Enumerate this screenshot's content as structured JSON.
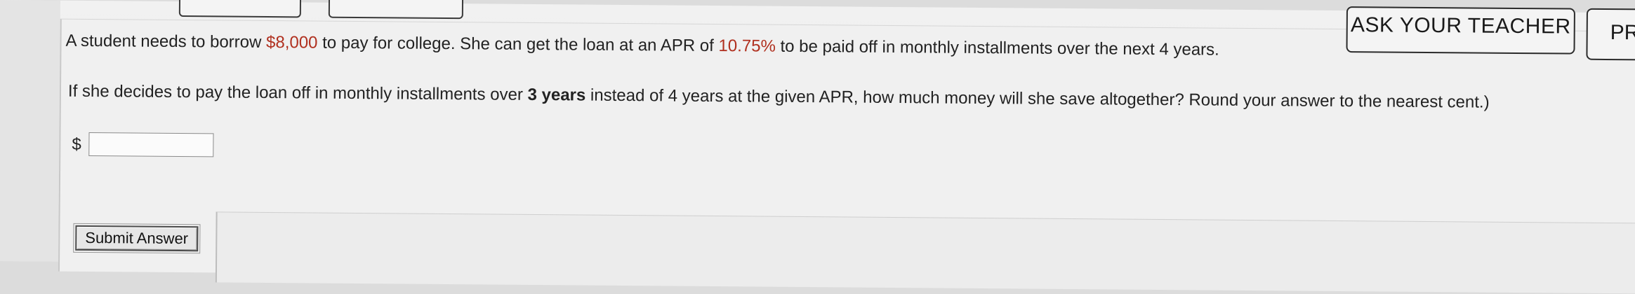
{
  "header": {
    "ask_teacher_label": "ASK YOUR TEACHER",
    "practice_label": "PR"
  },
  "question": {
    "intro_before_amount": "A student needs to borrow ",
    "loan_amount": "$8,000",
    "intro_after_amount": " to pay for college. She can get the loan at an APR of ",
    "apr": "10.75%",
    "intro_end": " to be paid off in monthly installments over the next 4 years.",
    "part_before_bold": "If she decides to pay the loan off in monthly installments over ",
    "bold_term": "3 years",
    "part_after_bold": " instead of 4 years at the given APR, how much money will she save altogether? Round your answer to the nearest cent.)"
  },
  "answer": {
    "currency_symbol": "$",
    "value": ""
  },
  "submit": {
    "label": "Submit Answer"
  }
}
